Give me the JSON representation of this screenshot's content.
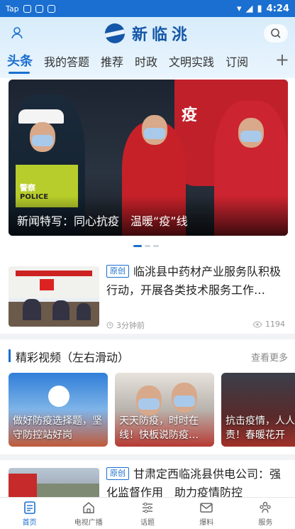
{
  "status_bar": {
    "carrier": "Tap",
    "time": "4:24"
  },
  "header": {
    "logo_text": "新临洮",
    "tabs": [
      {
        "label": "头条",
        "active": true
      },
      {
        "label": "我的答题"
      },
      {
        "label": "推荐"
      },
      {
        "label": "时政"
      },
      {
        "label": "文明实践"
      },
      {
        "label": "订阅"
      }
    ],
    "add_label": "+"
  },
  "banner": {
    "title": "新闻特写：同心抗疫　温暖“疫”线",
    "sign_text": "疫",
    "vest_text": "POLICE",
    "police_text": "警察"
  },
  "news": [
    {
      "badge": "原创",
      "title": "临洮县中药材产业服务队积极行动，开展各类技术服务工作…",
      "time": "3分钟前",
      "views": "1194"
    },
    {
      "badge": "原创",
      "title": "甘肃定西临洮县供电公司：强化监督作用　助力疫情防控"
    }
  ],
  "videos_section": {
    "title": "精彩视频（左右滑动）",
    "more": "查看更多",
    "items": [
      {
        "caption": "做好防疫选择题，坚守防控站好岗"
      },
      {
        "caption": "天天防疫，时时在线！快板说防疫…"
      },
      {
        "caption": "抗击疫情，人人有责！春暖花开"
      }
    ]
  },
  "bottom_nav": [
    {
      "label": "首页",
      "icon": "home-icon",
      "active": true
    },
    {
      "label": "电视广播",
      "icon": "house-icon"
    },
    {
      "label": "话题",
      "icon": "sliders-icon"
    },
    {
      "label": "爆料",
      "icon": "mail-icon"
    },
    {
      "label": "服务",
      "icon": "people-icon"
    }
  ],
  "colors": {
    "accent": "#1a6fd0",
    "header_bg": "#d7ecfb"
  }
}
